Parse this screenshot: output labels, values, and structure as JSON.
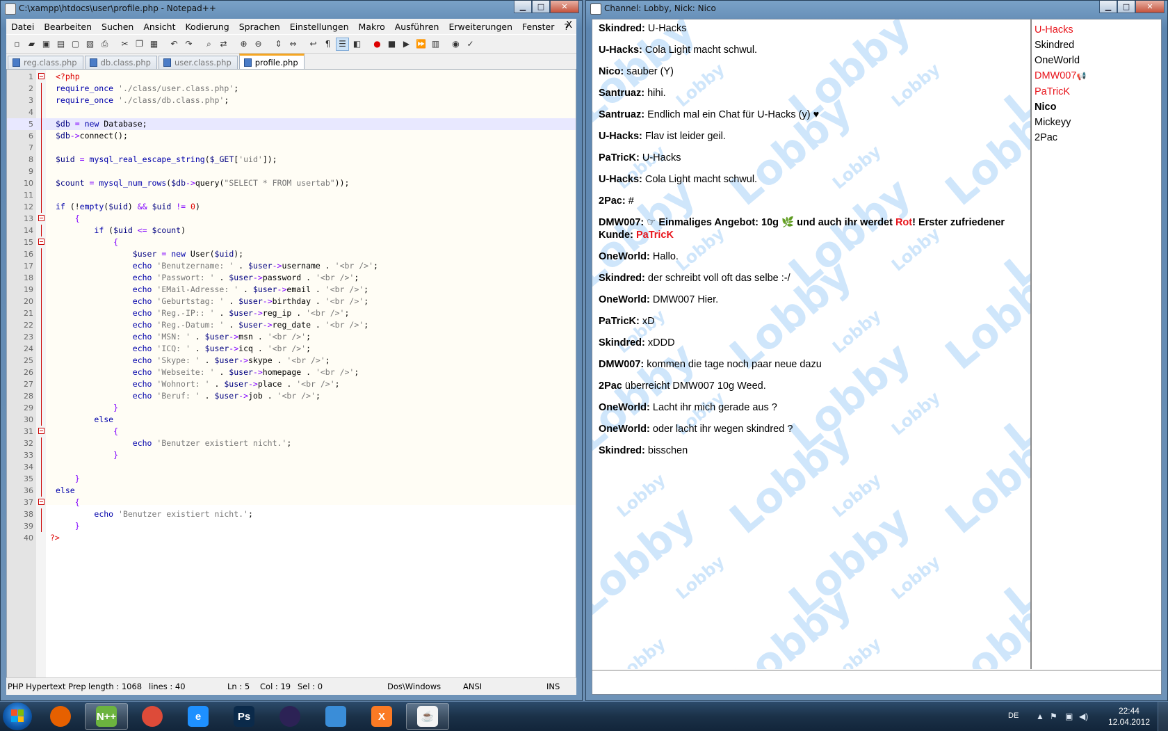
{
  "npp": {
    "title": "C:\\xampp\\htdocs\\user\\profile.php - Notepad++",
    "menu": [
      "Datei",
      "Bearbeiten",
      "Suchen",
      "Ansicht",
      "Kodierung",
      "Sprachen",
      "Einstellungen",
      "Makro",
      "Ausführen",
      "Erweiterungen",
      "Fenster",
      "?"
    ],
    "menu_close": "X",
    "tabs": [
      "reg.class.php",
      "db.class.php",
      "user.class.php",
      "profile.php"
    ],
    "active_tab": "profile.php",
    "current_line": 5,
    "status": {
      "lang": "PHP Hypertext Prepro",
      "length": "length : 1068",
      "lines": "lines : 40",
      "ln": "Ln : 5",
      "col": "Col : 19",
      "sel": "Sel : 0",
      "eol": "Dos\\Windows",
      "enc": "ANSI",
      "mode": "INS"
    }
  },
  "chat": {
    "title": "Channel: Lobby,  Nick: Nico",
    "watermark": "Lobby",
    "messages": [
      {
        "nick": "Skindred:",
        "text": "U-Hacks"
      },
      {
        "nick": "U-Hacks:",
        "text": "Cola Light macht schwul."
      },
      {
        "nick": "Nico:",
        "text": "sauber (Y)"
      },
      {
        "nick": "Santruaz:",
        "text": "hihi."
      },
      {
        "nick": "Santruaz:",
        "text": "Endlich mal ein Chat für U-Hacks (y) ♥"
      },
      {
        "nick": "U-Hacks:",
        "text": "Flav ist leider geil."
      },
      {
        "nick": "PaTricK:",
        "text": "U-Hacks"
      },
      {
        "nick": "U-Hacks:",
        "text": "Cola Light macht schwul."
      },
      {
        "nick": "2Pac:",
        "text": "#"
      },
      {
        "nick": "OneWorld:",
        "text": "Hallo."
      },
      {
        "nick": "Skindred:",
        "text": "der schreibt voll oft das selbe :-/"
      },
      {
        "nick": "OneWorld:",
        "text": "DMW007 Hier."
      },
      {
        "nick": "PaTricK:",
        "text": "xD"
      },
      {
        "nick": "Skindred:",
        "text": "xDDD"
      },
      {
        "nick": "DMW007:",
        "text": "kommen die tage noch paar neue dazu"
      },
      {
        "nick": "2Pac",
        "text": "überreicht DMW007 10g Weed."
      },
      {
        "nick": "OneWorld:",
        "text": "Lacht ihr mich gerade aus ?"
      },
      {
        "nick": "OneWorld:",
        "text": "oder lacht ihr wegen skindred ?"
      },
      {
        "nick": "Skindred:",
        "text": "bisschen"
      }
    ],
    "offer": {
      "nick": "DMW007:",
      "hand": "☞",
      "part1": "Einmaliges Angebot: 10g",
      "leaf": "🌿",
      "part2": "und auch ihr werdet",
      "rot": "Rot",
      "part3": "! Erster zufriedener Kunde:",
      "target": "PaTricK"
    },
    "users": [
      {
        "name": "U-Hacks",
        "color": "#e8141b",
        "bold": false
      },
      {
        "name": "Skindred",
        "color": "#000000",
        "bold": false
      },
      {
        "name": "OneWorld",
        "color": "#000000",
        "bold": false
      },
      {
        "name": "DMW007",
        "color": "#e8141b",
        "bold": false,
        "badge": "📢"
      },
      {
        "name": "PaTricK",
        "color": "#e8141b",
        "bold": false
      },
      {
        "name": "Nico",
        "color": "#000000",
        "bold": true
      },
      {
        "name": "Mickeyy",
        "color": "#000000",
        "bold": false
      },
      {
        "name": "2Pac",
        "color": "#000000",
        "bold": false
      }
    ]
  },
  "taskbar": {
    "apps": [
      {
        "name": "firefox",
        "label": "",
        "color": "#e66000",
        "open": false
      },
      {
        "name": "notepadpp",
        "label": "N++",
        "color": "#6cb33f",
        "open": true
      },
      {
        "name": "chrome",
        "label": "",
        "color": "#dd4b39",
        "open": false
      },
      {
        "name": "ie",
        "label": "e",
        "color": "#1e90ff",
        "open": false
      },
      {
        "name": "photoshop",
        "label": "Ps",
        "color": "#0b2a4a",
        "open": false
      },
      {
        "name": "eclipse",
        "label": "",
        "color": "#2c2255",
        "open": false
      },
      {
        "name": "messenger",
        "label": "",
        "color": "#3a8dd8",
        "open": false
      },
      {
        "name": "xampp",
        "label": "X",
        "color": "#fb7a24",
        "open": false
      },
      {
        "name": "java",
        "label": "☕",
        "color": "#f4f4f4",
        "open": true
      }
    ],
    "lang": "DE",
    "time": "22:44",
    "date": "12.04.2012"
  }
}
